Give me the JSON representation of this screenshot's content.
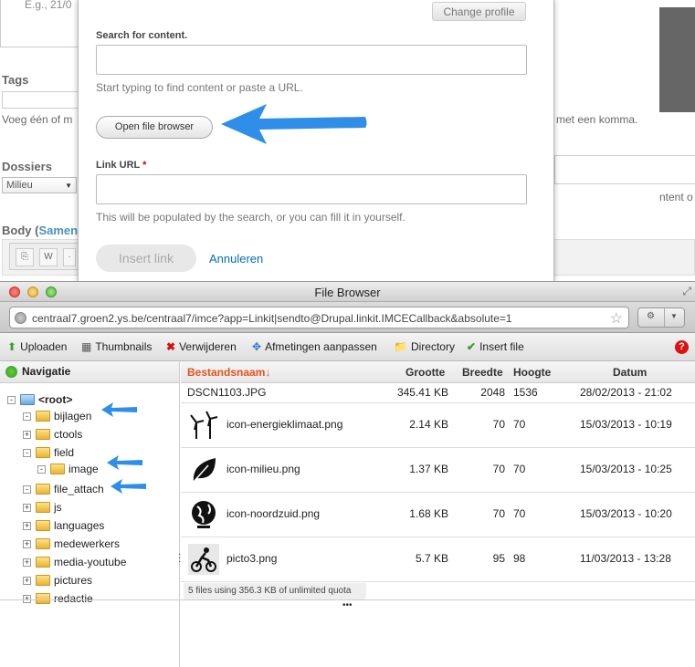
{
  "background": {
    "top_field_placeholder": "E.g., 21/0",
    "tags_label": "Tags",
    "tags_hint_left": "Voeg één of m",
    "tags_hint_right": "met een komma.",
    "dossiers_label": "Dossiers",
    "dossiers_value": "Milieu",
    "right_hint": "ntent o",
    "body_label": "Body (",
    "body_link": "Samen"
  },
  "modal": {
    "change_profile": "Change profile",
    "search_label": "Search for content.",
    "search_value": "",
    "search_desc": "Start typing to find content or paste a URL.",
    "open_file_browser": "Open file browser",
    "link_url_label": "Link URL",
    "required_mark": "*",
    "link_url_value": "",
    "link_url_desc": "This will be populated by the search, or you can fill it in yourself.",
    "insert_link": "Insert link",
    "cancel": "Annuleren"
  },
  "file_browser": {
    "title": "File Browser",
    "url": "centraal7.groen2.ys.be/centraal7/imce?app=Linkit|sendto@Drupal.linkit.IMCECallback&absolute=1",
    "toolbar": [
      {
        "label": "Uploaden",
        "icon": "upload-icon",
        "color": "#3a9d2b"
      },
      {
        "label": "Thumbnails",
        "icon": "thumbnails-icon",
        "color": "#555555"
      },
      {
        "label": "Verwijderen",
        "icon": "delete-icon",
        "color": "#d11111"
      },
      {
        "label": "Afmetingen aanpassen",
        "icon": "resize-icon",
        "color": "#2a78c8"
      },
      {
        "label": "Directory",
        "icon": "directory-icon",
        "color": "#e0a92a"
      },
      {
        "label": "Insert file",
        "icon": "checkmark-icon",
        "color": "#3a9d2b"
      }
    ],
    "help": "?",
    "nav_title": "Navigatie",
    "tree": [
      {
        "label": "<root>",
        "expander": "-",
        "level": 0
      },
      {
        "label": "bijlagen",
        "expander": "-",
        "level": 1
      },
      {
        "label": "ctools",
        "expander": "+",
        "level": 1
      },
      {
        "label": "field",
        "expander": "-",
        "level": 1
      },
      {
        "label": "image",
        "expander": "-",
        "level": 2
      },
      {
        "label": "file_attach",
        "expander": "-",
        "level": 1
      },
      {
        "label": "js",
        "expander": "+",
        "level": 1
      },
      {
        "label": "languages",
        "expander": "+",
        "level": 1
      },
      {
        "label": "medewerkers",
        "expander": "+",
        "level": 1
      },
      {
        "label": "media-youtube",
        "expander": "+",
        "level": 1
      },
      {
        "label": "pictures",
        "expander": "+",
        "level": 1
      },
      {
        "label": "redactie",
        "expander": "+",
        "level": 1
      }
    ],
    "columns": {
      "name": "Bestandsnaam↓",
      "size": "Grootte",
      "width": "Breedte",
      "height": "Hoogte",
      "date": "Datum"
    },
    "files": [
      {
        "name": "DSCN1103.JPG",
        "size": "345.41 KB",
        "width": "2048",
        "height": "1536",
        "date": "28/02/2013 - 21:02",
        "thumb": null
      },
      {
        "name": "icon-energieklimaat.png",
        "size": "2.14 KB",
        "width": "70",
        "height": "70",
        "date": "15/03/2013 - 10:19",
        "thumb": "wind-turbine-icon"
      },
      {
        "name": "icon-milieu.png",
        "size": "1.37 KB",
        "width": "70",
        "height": "70",
        "date": "15/03/2013 - 10:25",
        "thumb": "leaf-icon"
      },
      {
        "name": "icon-noordzuid.png",
        "size": "1.68 KB",
        "width": "70",
        "height": "70",
        "date": "15/03/2013 - 10:20",
        "thumb": "globe-icon"
      },
      {
        "name": "picto3.png",
        "size": "5.7 KB",
        "width": "95",
        "height": "98",
        "date": "11/03/2013 - 13:28",
        "thumb": "cyclist-icon"
      }
    ],
    "status": "5 files using 356.3 KB of unlimited quota"
  },
  "colors": {
    "accent_arrow": "#2f8fe8",
    "link": "#0071b3",
    "sort_header": "#e5531b"
  }
}
